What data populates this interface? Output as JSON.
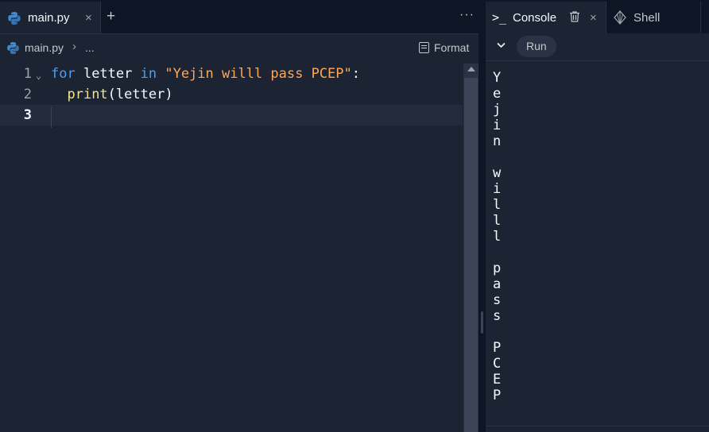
{
  "editor": {
    "tab": {
      "label": "main.py",
      "close": "×"
    },
    "add_tab": "+",
    "more": "···",
    "breadcrumb": {
      "file": "main.py",
      "separator": "›",
      "more": "..."
    },
    "format_label": "Format",
    "code_lines": [
      {
        "number": "1",
        "tokens": [
          {
            "t": "for",
            "c": "kw"
          },
          {
            "t": " letter ",
            "c": "var"
          },
          {
            "t": "in",
            "c": "kw"
          },
          {
            "t": " ",
            "c": "var"
          },
          {
            "t": "\"Yejin willl pass PCEP\"",
            "c": "str"
          },
          {
            "t": ":",
            "c": "var"
          }
        ]
      },
      {
        "number": "2",
        "tokens": [
          {
            "t": "  ",
            "c": "var"
          },
          {
            "t": "print",
            "c": "fn"
          },
          {
            "t": "(letter)",
            "c": "var"
          }
        ]
      },
      {
        "number": "3",
        "tokens": []
      }
    ],
    "current_line": 3
  },
  "console": {
    "tab_label": "Console",
    "prompt_icon": ">_",
    "close": "×",
    "shell_label": "Shell",
    "run_label": "Run",
    "output_lines": [
      "Y",
      "e",
      "j",
      "i",
      "n",
      " ",
      "w",
      "i",
      "l",
      "l",
      "l",
      " ",
      "p",
      "a",
      "s",
      "s",
      " ",
      "P",
      "C",
      "E",
      "P"
    ]
  },
  "colors": {
    "background": "#1c2333",
    "tabbar": "#0e1525",
    "keyword": "#4d9ff0",
    "string": "#ffa657",
    "function": "#f5e28a",
    "text": "#f5f9fc"
  }
}
